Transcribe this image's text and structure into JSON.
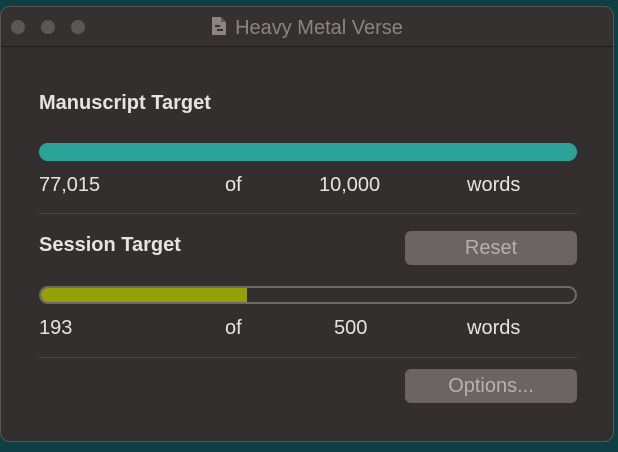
{
  "window": {
    "title": "Heavy Metal Verse",
    "title_icon": "document-icon"
  },
  "manuscript": {
    "heading": "Manuscript Target",
    "current": "77,015",
    "of_label": "of",
    "target": "10,000",
    "unit": "words",
    "progress_fraction": 1.0,
    "bar_color": "#2ba399"
  },
  "session": {
    "heading": "Session Target",
    "reset_label": "Reset",
    "current": "193",
    "of_label": "of",
    "target": "500",
    "unit": "words",
    "progress_fraction": 0.386,
    "bar_color": "#95a007"
  },
  "footer": {
    "options_label": "Options..."
  }
}
